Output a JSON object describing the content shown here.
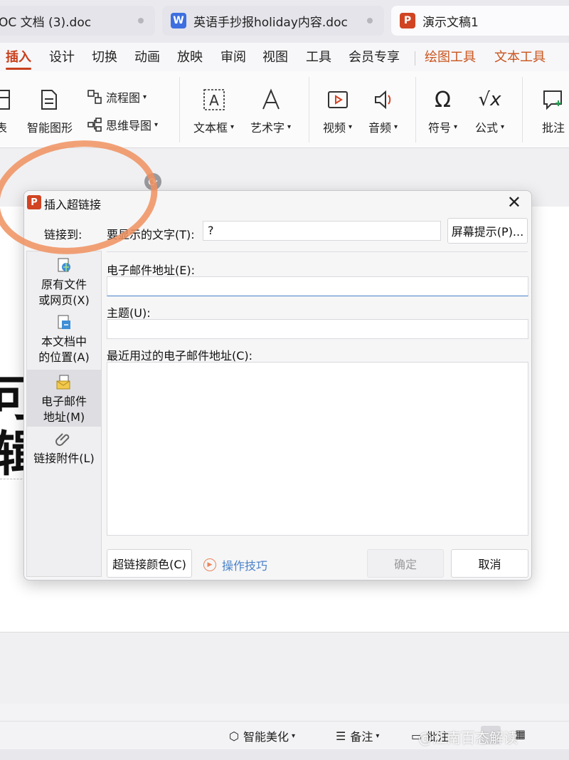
{
  "tabs": [
    {
      "label": "OC 文档 (3).doc",
      "icon": "doc-icon"
    },
    {
      "label": "英语手抄报holiday内容.doc",
      "icon": "W"
    },
    {
      "label": "演示文稿1",
      "icon": "P"
    }
  ],
  "menu": [
    "插入",
    "设计",
    "切换",
    "动画",
    "放映",
    "审阅",
    "视图",
    "工具",
    "会员专享",
    "绘图工具",
    "文本工具"
  ],
  "ribbon": {
    "table": "表",
    "smart_graphic": "智能图形",
    "flowchart": "流程图",
    "mindmap": "思维导图",
    "textbox": "文本框",
    "wordart": "艺术字",
    "video": "视频",
    "audio": "音频",
    "symbol": "符号",
    "formula": "公式",
    "comment": "批注"
  },
  "slide": {
    "text_1": "可",
    "text_2": "辑"
  },
  "dialog": {
    "title": "插入超链接",
    "link_to": "链接到:",
    "display_text_label": "要显示的文字(T):",
    "display_text_value": "?",
    "screen_tip": "屏幕提示(P)...",
    "email_label": "电子邮件地址(E):",
    "email_value": "",
    "subject_label": "主题(U):",
    "subject_value": "",
    "recent_label": "最近用过的电子邮件地址(C):",
    "left_items": [
      {
        "label": "原有文件\n或网页(X)"
      },
      {
        "label": "本文档中\n的位置(A)"
      },
      {
        "label": "电子邮件\n地址(M)"
      },
      {
        "label": "链接附件(L)"
      }
    ],
    "color_btn": "超链接颜色(C)",
    "tips": "操作技巧",
    "ok": "确定",
    "cancel": "取消"
  },
  "status": {
    "beautify": "智能美化",
    "notes": "备注",
    "comment": "批注"
  },
  "watermark": "@江南百态解读"
}
